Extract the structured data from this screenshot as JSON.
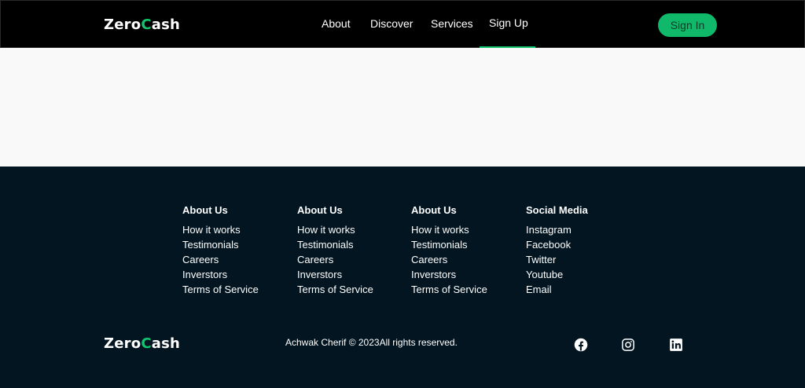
{
  "navbar": {
    "logo": {
      "part1": "Zero",
      "part2": "C",
      "part3": "ash"
    },
    "links": [
      "About",
      "Discover",
      "Services",
      "Sign Up"
    ],
    "signin": "Sign In"
  },
  "footer": {
    "columns": [
      {
        "title": "About Us",
        "items": [
          "How it works",
          "Testimonials",
          "Careers",
          "Inverstors",
          "Terms of Service"
        ]
      },
      {
        "title": "About Us",
        "items": [
          "How it works",
          "Testimonials",
          "Careers",
          "Inverstors",
          "Terms of Service"
        ]
      },
      {
        "title": "About Us",
        "items": [
          "How it works",
          "Testimonials",
          "Careers",
          "Inverstors",
          "Terms of Service"
        ]
      },
      {
        "title": "Social Media",
        "items": [
          "Instagram",
          "Facebook",
          "Twitter",
          "Youtube",
          "Email"
        ]
      }
    ],
    "logo": {
      "part1": "Zero",
      "part2": "C",
      "part3": "ash"
    },
    "copyright": "Achwak Cherif © 2023All rights reserved.",
    "social_icons": [
      "facebook-icon",
      "instagram-icon",
      "linkedin-icon"
    ]
  },
  "colors": {
    "accent": "#10c76f",
    "navbar_bg": "#000000",
    "footer_bg": "#021520",
    "content_bg": "#f9f9f9"
  }
}
